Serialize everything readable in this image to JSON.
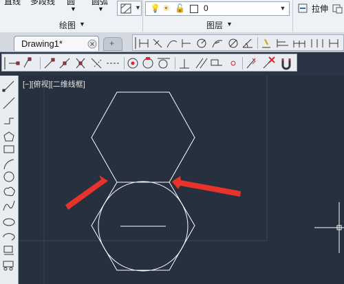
{
  "ribbon": {
    "top_clip_texts": [
      "直线",
      "多段线",
      "圆",
      "圆弧"
    ],
    "draw_panel_label": "绘图",
    "layer_panel_label": "图层",
    "layer_value": "0",
    "stretch_label": "拉伸",
    "dropdown_arrow": "▼"
  },
  "tabs": {
    "drawing_tab": "Drawing1*",
    "new_tab_icon": "+"
  },
  "viewport": {
    "label": "[−][俯视][二维线框]"
  },
  "colors": {
    "canvas": "#26303e",
    "geometry": "#ffffff",
    "arrow": "#e8332a",
    "toolbar": "#e9edf2"
  },
  "icons": {
    "top_toolbar": [
      "linear-dim-icon",
      "aligned-dim-icon",
      "arc-length-icon",
      "ordinate-dim-icon",
      "radius-dim-icon",
      "jogged-dim-icon",
      "diameter-dim-icon",
      "angular-dim-icon",
      "quick-dim-icon",
      "baseline-dim-icon",
      "continue-dim-icon",
      "space-icon",
      "break-icon",
      "tolerance-icon"
    ],
    "snap_toolbar": [
      "temp-track-icon",
      "snap-from-icon",
      "endpoint-icon",
      "midpoint-icon",
      "intersection-icon",
      "apparent-int-icon",
      "extension-icon",
      "center-icon",
      "quadrant-icon",
      "tangent-icon",
      "perpendicular-icon",
      "parallel-icon",
      "insert-icon",
      "node-icon",
      "nearest-icon",
      "snap-none-icon",
      "osnap-settings-icon"
    ],
    "left_toolbar": [
      "line-icon",
      "construction-line-icon",
      "polyline-icon",
      "polygon-icon",
      "rectangle-icon",
      "arc-icon",
      "circle-icon",
      "revcloud-icon",
      "spline-icon",
      "ellipse-icon",
      "ellipse-arc-icon",
      "insert-block-icon",
      "make-block-icon"
    ]
  }
}
